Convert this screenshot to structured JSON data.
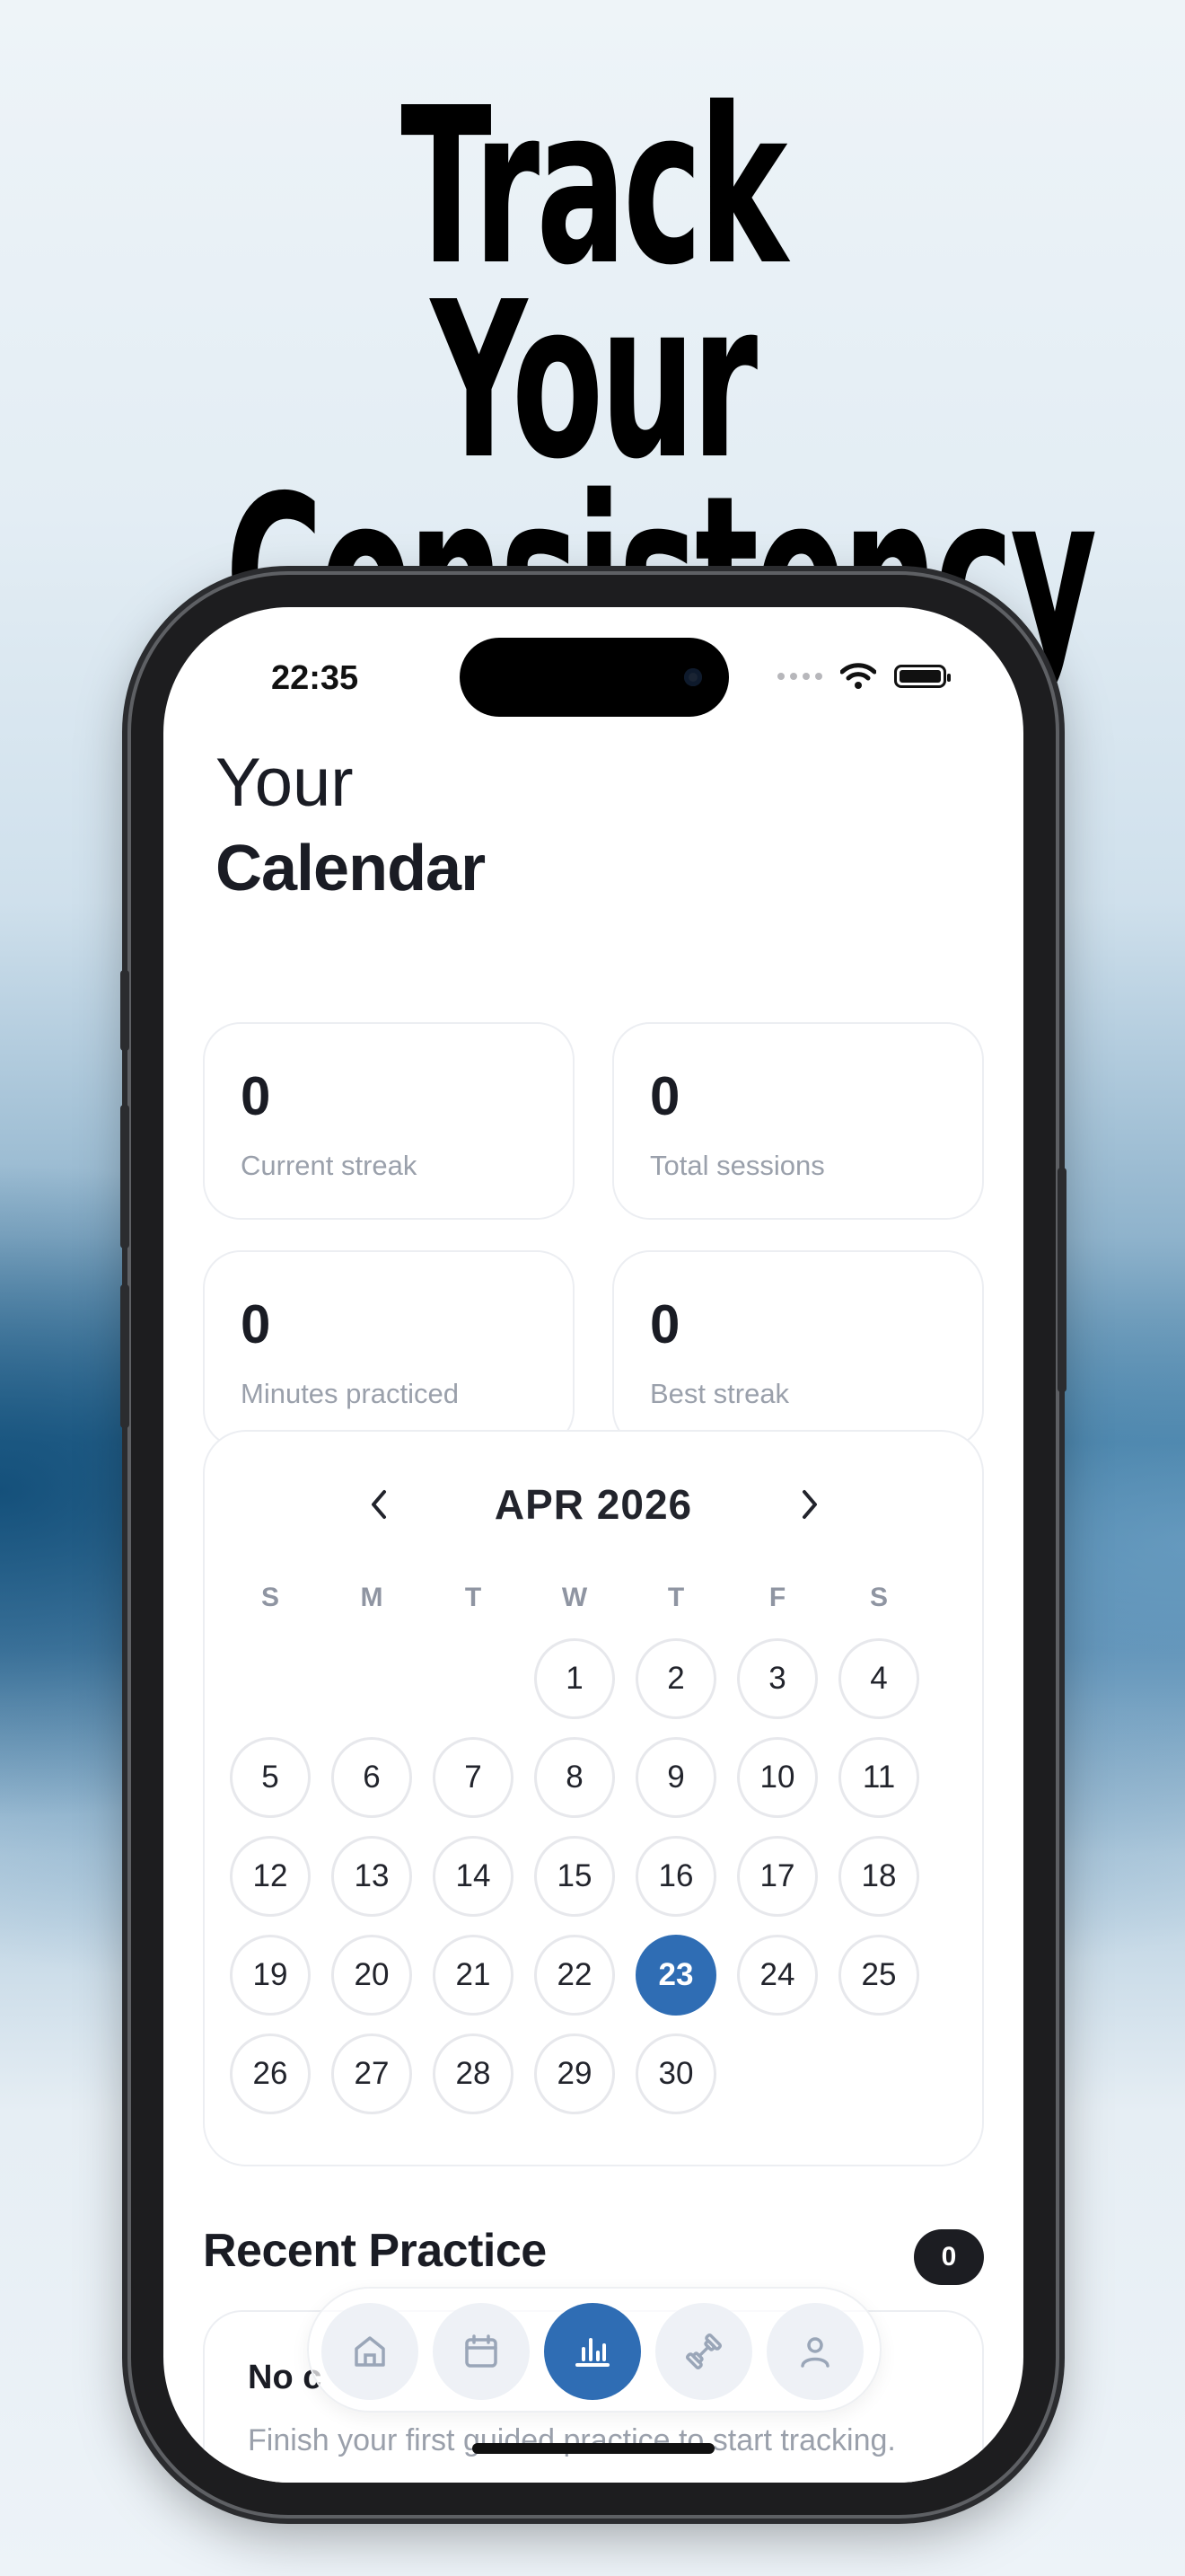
{
  "headline": {
    "line1": "Track Your",
    "line2": "Consistency"
  },
  "status_bar": {
    "time": "22:35"
  },
  "page": {
    "title_light": "Your",
    "title_bold": "Calendar"
  },
  "stats": [
    {
      "value": "0",
      "label": "Current streak"
    },
    {
      "value": "0",
      "label": "Total sessions"
    },
    {
      "value": "0",
      "label": "Minutes practiced"
    },
    {
      "value": "0",
      "label": "Best streak"
    }
  ],
  "calendar": {
    "month_label": "APR 2026",
    "weekdays": [
      "S",
      "M",
      "T",
      "W",
      "T",
      "F",
      "S"
    ],
    "days": [
      "1",
      "2",
      "3",
      "4",
      "5",
      "6",
      "7",
      "8",
      "9",
      "10",
      "11",
      "12",
      "13",
      "14",
      "15",
      "16",
      "17",
      "18",
      "19",
      "20",
      "21",
      "22",
      "23",
      "24",
      "25",
      "26",
      "27",
      "28",
      "29",
      "30"
    ],
    "selected_day": "23",
    "accent_color": "#2f6db4"
  },
  "recent": {
    "title": "Recent Practice",
    "count": "0",
    "empty_title_visible": "No c",
    "empty_subtitle": "Finish your first guided practice to start tracking."
  },
  "tab_bar": {
    "tabs": [
      {
        "icon": "home-icon",
        "active": false
      },
      {
        "icon": "calendar-icon",
        "active": false
      },
      {
        "icon": "chart-icon",
        "active": true
      },
      {
        "icon": "dumbbell-icon",
        "active": false
      },
      {
        "icon": "person-icon",
        "active": false
      }
    ]
  }
}
